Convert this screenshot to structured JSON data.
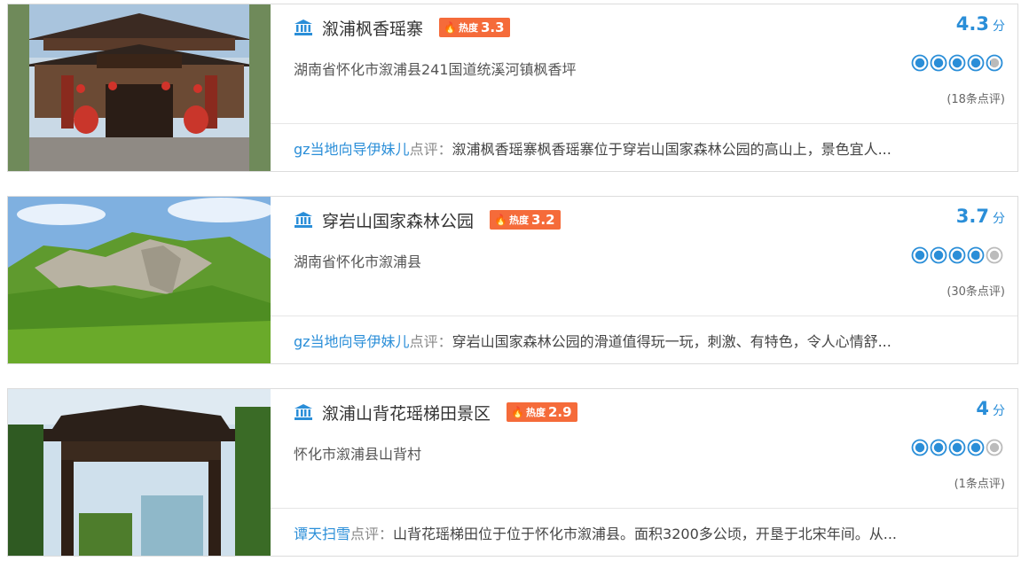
{
  "colors": {
    "accent": "#2a8ed8",
    "heat_badge": "#f56b3a",
    "border": "#dcdcdc"
  },
  "icons": {
    "poi": "landmark-icon",
    "heat": "flame-icon",
    "rating": "circle-rating-icon"
  },
  "cards": [
    {
      "title": "溆浦枫香瑶寨",
      "heat_label": "热度",
      "heat_value": "3.3",
      "address": "湖南省怀化市溆浦县241国道统溪河镇枫香坪",
      "score": "4.3",
      "score_unit": "分",
      "rating": 4.3,
      "reviews": "(18条点评)",
      "comment_user": "gz当地向导伊妹儿",
      "comment_label": "点评：",
      "comment_text": "溆浦枫香瑶寨枫香瑶寨位于穿岩山国家森林公园的高山上，景色宜人..."
    },
    {
      "title": "穿岩山国家森林公园",
      "heat_label": "热度",
      "heat_value": "3.2",
      "address": "湖南省怀化市溆浦县",
      "score": "3.7",
      "score_unit": "分",
      "rating": 3.7,
      "reviews": "(30条点评)",
      "comment_user": "gz当地向导伊妹儿",
      "comment_label": "点评：",
      "comment_text": "穿岩山国家森林公园的滑道值得玩一玩，刺激、有特色，令人心情舒..."
    },
    {
      "title": "溆浦山背花瑶梯田景区",
      "heat_label": "热度",
      "heat_value": "2.9",
      "address": "怀化市溆浦县山背村",
      "score": "4",
      "score_unit": "分",
      "rating": 4.0,
      "reviews": "(1条点评)",
      "comment_user": "谭天扫雪",
      "comment_label": "点评：",
      "comment_text": "山背花瑶梯田位于位于怀化市溆浦县。面积3200多公顷，开垦于北宋年间。从..."
    }
  ]
}
